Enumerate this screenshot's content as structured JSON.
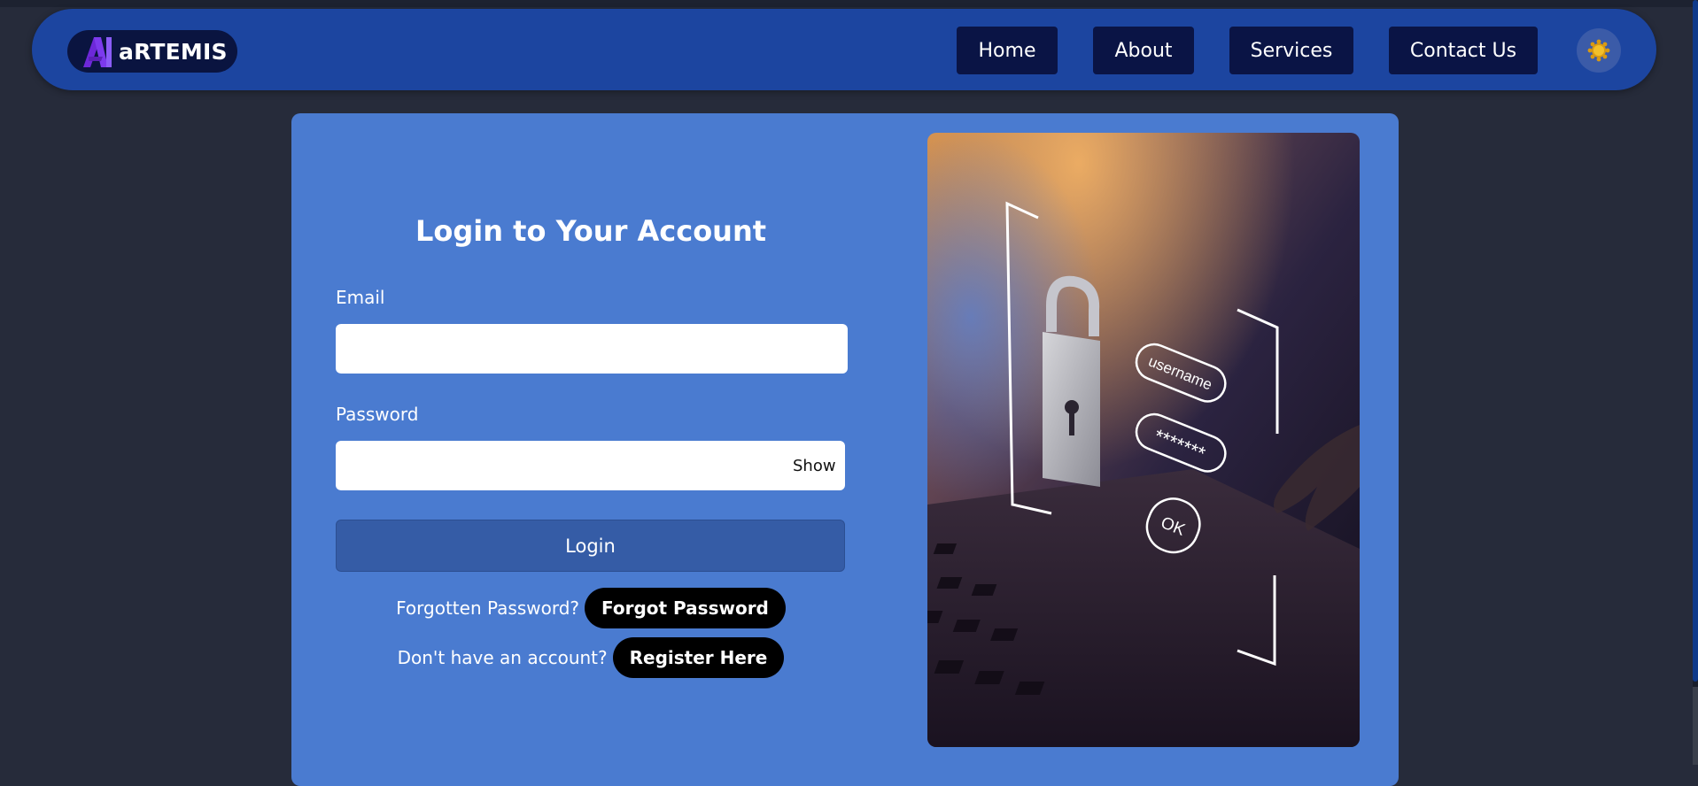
{
  "brand": {
    "name": "aRTEMIS",
    "logo_icon": "ai-logo-icon"
  },
  "nav": {
    "items": [
      {
        "label": "Home"
      },
      {
        "label": "About"
      },
      {
        "label": "Services"
      },
      {
        "label": "Contact Us"
      }
    ],
    "theme_toggle_icon": "sun-icon"
  },
  "login": {
    "title": "Login to Your Account",
    "email_label": "Email",
    "email_value": "",
    "password_label": "Password",
    "password_value": "",
    "show_label": "Show",
    "login_button": "Login",
    "forgot_text": "Forgotten Password?",
    "forgot_button": "Forgot Password",
    "register_text": "Don't have an account?",
    "register_button": "Register Here"
  },
  "image": {
    "fields": [
      "username",
      "*******",
      "OK"
    ],
    "icons": [
      "padlock-icon"
    ]
  },
  "colors": {
    "page_bg": "#262b3a",
    "navbar_bg": "#1c45a0",
    "nav_button_bg": "#0a1445",
    "card_bg": "#4a7bd0",
    "login_button_bg": "#355ca6",
    "pill_bg": "#000000"
  }
}
